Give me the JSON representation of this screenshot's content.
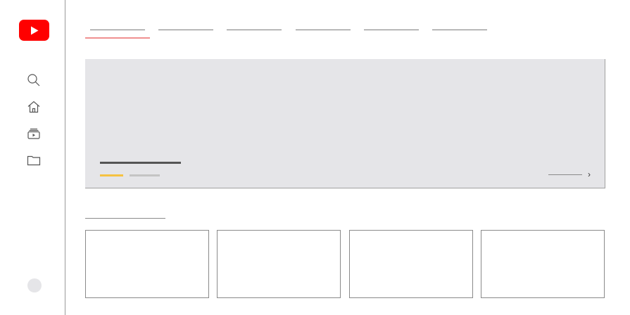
{
  "sidebar": {
    "logo_icon": "youtube-play-logo",
    "brand_color": "#ff0000",
    "nav": [
      {
        "icon": "search-icon"
      },
      {
        "icon": "home-icon"
      },
      {
        "icon": "subscriptions-icon"
      },
      {
        "icon": "library-folder-icon"
      }
    ],
    "avatar_icon": "avatar-placeholder"
  },
  "tabs": [
    {
      "label": ""
    },
    {
      "label": ""
    },
    {
      "label": ""
    },
    {
      "label": ""
    },
    {
      "label": ""
    },
    {
      "label": ""
    }
  ],
  "tabs_active_index": 0,
  "hero": {
    "title": "",
    "slide_count": 2,
    "active_slide": 1,
    "see_more_label": "",
    "colors": {
      "background": "#e5e5e8",
      "active_indicator": "#f5c242",
      "inactive_indicator": "#c4c4c4"
    }
  },
  "section": {
    "heading": "",
    "cards": [
      {
        "title": ""
      },
      {
        "title": ""
      },
      {
        "title": ""
      },
      {
        "title": ""
      }
    ]
  },
  "accent_color": "#f09090"
}
